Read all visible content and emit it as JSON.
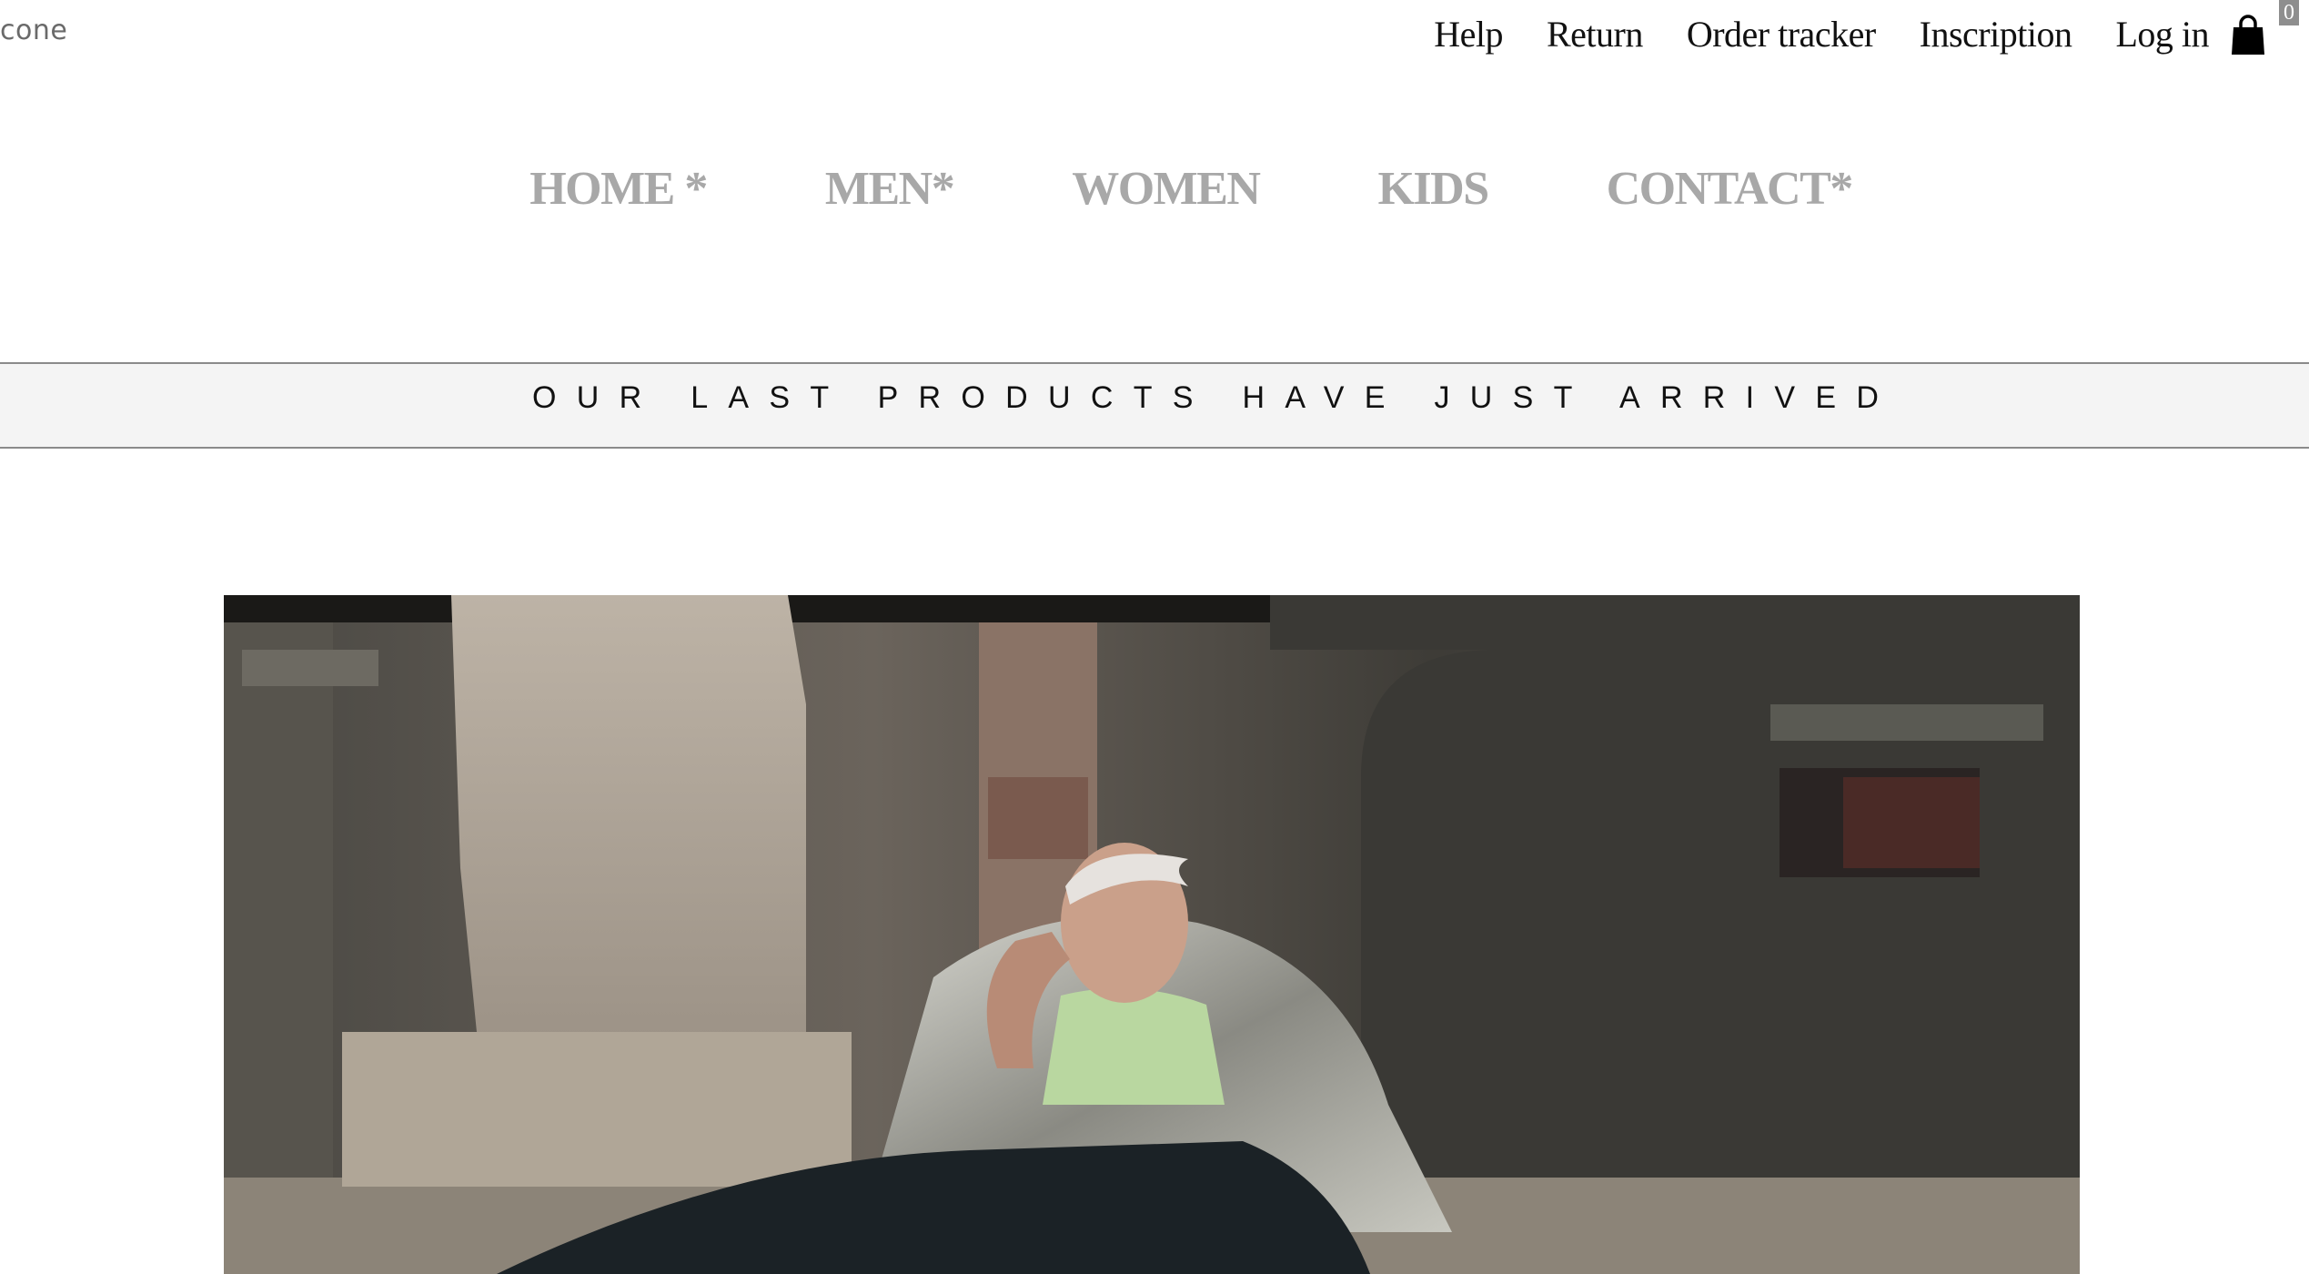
{
  "header": {
    "logo_text": "cone",
    "util_links": [
      "Help",
      "Return",
      "Order tracker",
      "Inscription",
      "Log in"
    ],
    "cart_count": "0"
  },
  "main_nav": {
    "items": [
      "HOME *",
      "MEN*",
      "WOMEN",
      "KIDS",
      "CONTACT*"
    ]
  },
  "banner": {
    "text": "OUR LAST PRODUCTS HAVE JUST ARRIVED"
  },
  "icons": {
    "cart": "shopping-bag-icon"
  },
  "colors": {
    "nav_gray": "#a8a8a8",
    "banner_bg": "#f4f4f4",
    "text_dark": "#111111"
  }
}
